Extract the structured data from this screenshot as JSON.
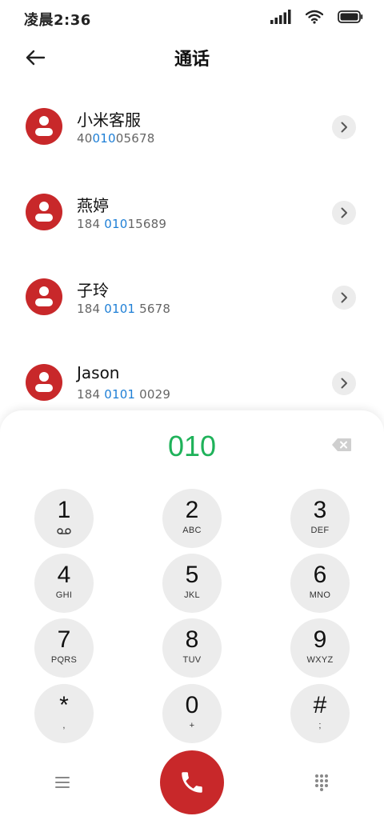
{
  "status_bar": {
    "time": "凌晨2:36",
    "icons": [
      "signal-icon",
      "wifi-icon",
      "battery-icon"
    ]
  },
  "header": {
    "title": "通话",
    "back_icon": "back-arrow-icon"
  },
  "contacts": [
    {
      "name": "小米客服",
      "number_parts": [
        "40",
        "010",
        "05678"
      ]
    },
    {
      "name": "燕婷",
      "number_parts": [
        "184 ",
        "010",
        "15689"
      ]
    },
    {
      "name": "子玲",
      "number_parts": [
        "184 ",
        "0101",
        " 5678"
      ]
    },
    {
      "name": "Jason",
      "number_parts": [
        "184 ",
        "0101",
        " 0029"
      ]
    }
  ],
  "dialpad": {
    "input_value": "010",
    "keys": [
      {
        "digit": "1",
        "letters": ""
      },
      {
        "digit": "2",
        "letters": "ABC"
      },
      {
        "digit": "3",
        "letters": "DEF"
      },
      {
        "digit": "4",
        "letters": "GHI"
      },
      {
        "digit": "5",
        "letters": "JKL"
      },
      {
        "digit": "6",
        "letters": "MNO"
      },
      {
        "digit": "7",
        "letters": "PQRS"
      },
      {
        "digit": "8",
        "letters": "TUV"
      },
      {
        "digit": "9",
        "letters": "WXYZ"
      },
      {
        "digit": "*",
        "letters": ","
      },
      {
        "digit": "0",
        "letters": "+"
      },
      {
        "digit": "#",
        "letters": ";"
      }
    ]
  },
  "colors": {
    "accent_red": "#c8282a",
    "highlight_blue": "#1e7fd6",
    "input_green": "#1fb25a",
    "key_gray": "#ececec"
  }
}
